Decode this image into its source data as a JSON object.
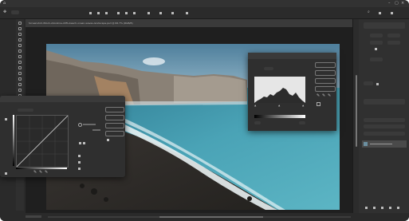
{
  "app": {
    "document_tab_title": "Screenshot-iStock-shoreline-cliffs-beach-ocean-waves-landscape.psd @ 66.7% (RGB/8)"
  },
  "colors": {
    "chrome": "#2a2a2a",
    "panel": "#303030",
    "sea": "#3f8fa3",
    "sand": "#2e2c2a"
  },
  "toolbar": {
    "tools": [
      "move-tool",
      "marquee-tool",
      "lasso-tool",
      "magic-wand-tool",
      "crop-tool",
      "eyedropper-tool",
      "healing-tool",
      "brush-tool",
      "clone-stamp-tool",
      "history-brush-tool",
      "eraser-tool",
      "gradient-tool",
      "blur-tool",
      "dodge-tool",
      "pen-tool",
      "type-tool",
      "path-selection-tool",
      "shape-tool",
      "hand-tool",
      "zoom-tool"
    ]
  },
  "curves_dialog": {
    "icons": [
      "eyedropper-black-icon",
      "eyedropper-gray-icon",
      "eyedropper-white-icon"
    ]
  },
  "levels_dialog": {
    "icons": [
      "eyedropper-black-icon",
      "eyedropper-gray-icon",
      "eyedropper-white-icon"
    ]
  }
}
